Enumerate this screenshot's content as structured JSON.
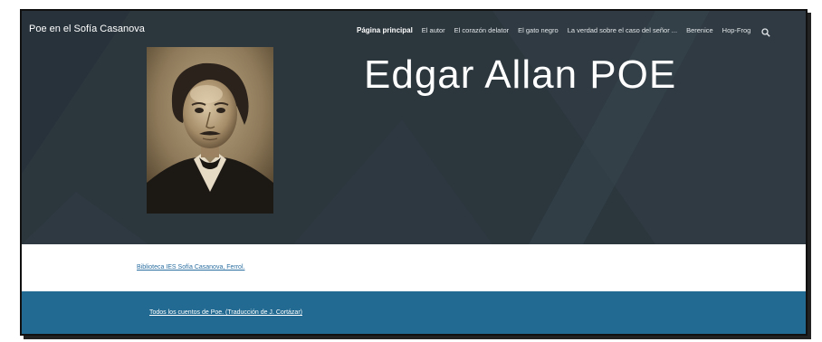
{
  "site": {
    "title": "Poe en el Sofía Casanova"
  },
  "nav": {
    "items": [
      {
        "label": "Página principal",
        "active": true
      },
      {
        "label": "El autor"
      },
      {
        "label": "El corazón delator"
      },
      {
        "label": "El gato negro"
      },
      {
        "label": "La verdad sobre el caso del señor ..."
      },
      {
        "label": "Berenice"
      },
      {
        "label": "Hop-Frog"
      }
    ],
    "search_icon": "search-icon"
  },
  "hero": {
    "heading": "Edgar Allan POE",
    "image": "portrait-photo-edgar-allan-poe"
  },
  "links": {
    "library": "Biblioteca IES Sofía Casanova, Ferrol.",
    "stories": "Todos los cuentos de Poe. (Traducción de J. Cortázar)"
  },
  "colors": {
    "hero_bg": "#2b363d",
    "band_blue": "#226a91",
    "link": "#2a6ea0"
  }
}
